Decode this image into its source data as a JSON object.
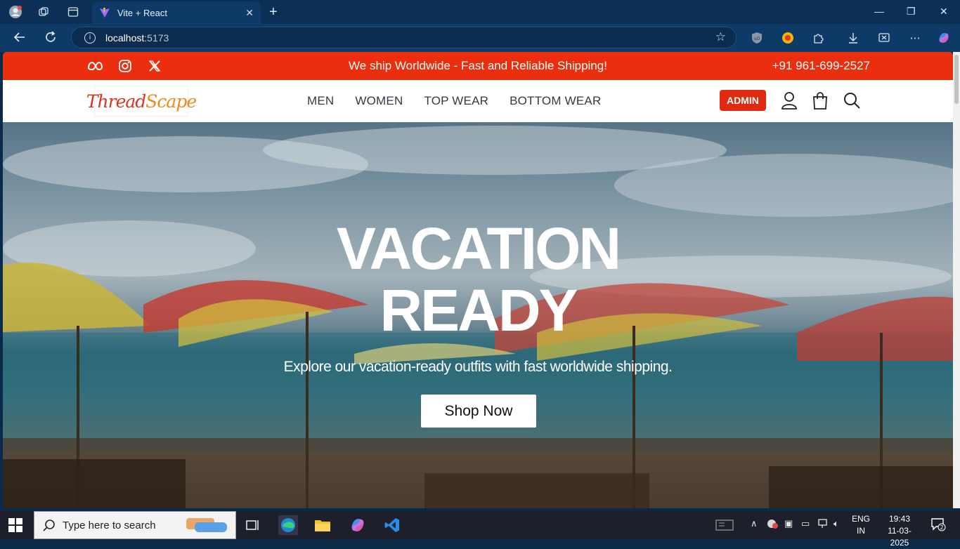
{
  "browser": {
    "tab_title": "Vite + React",
    "url_host": "localhost",
    "url_port": ":5173"
  },
  "site": {
    "topbar": {
      "message": "We ship Worldwide - Fast and Reliable Shipping!",
      "phone": "+91 961-699-2527",
      "socials": [
        "meta-icon",
        "instagram-icon",
        "x-twitter-icon"
      ]
    },
    "logo": {
      "part1": "Thread",
      "part2": "Scape"
    },
    "menu": [
      "MEN",
      "WOMEN",
      "TOP WEAR",
      "BOTTOM WEAR"
    ],
    "admin_label": "ADMIN",
    "hero": {
      "title_line1": "VACATION",
      "title_line2": "READY",
      "subtitle": "Explore our vacation-ready outfits with fast worldwide shipping.",
      "cta": "Shop Now"
    },
    "colors": {
      "brand_red": "#ea2e0e",
      "admin_red": "#e02a10",
      "logo_orange": "#f08a1c"
    }
  },
  "taskbar": {
    "search_placeholder": "Type here to search",
    "lang_line1": "ENG",
    "lang_line2": "IN",
    "time": "19:43",
    "date": "11-03-2025",
    "notifications": "2"
  }
}
